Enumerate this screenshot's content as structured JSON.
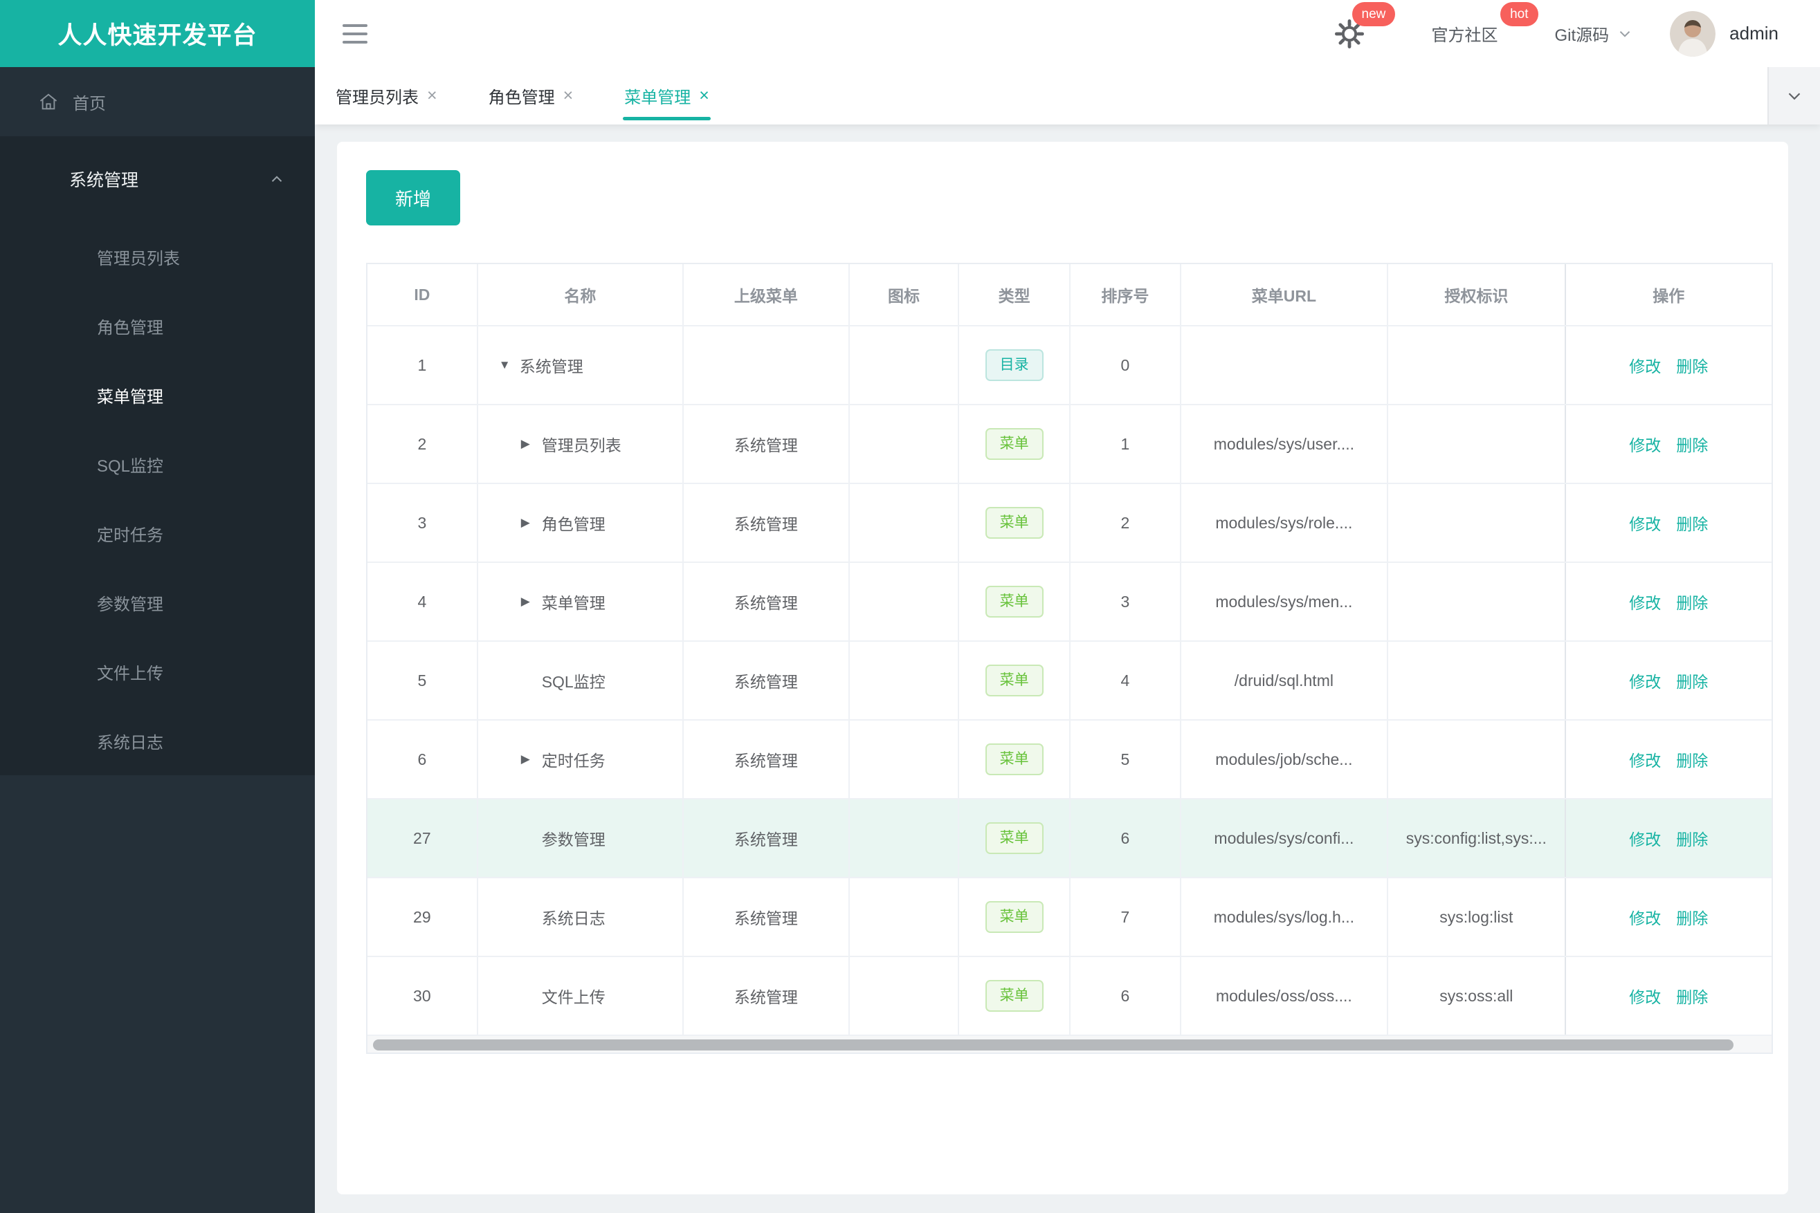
{
  "app": {
    "title": "人人快速开发平台"
  },
  "header": {
    "gear_badge": "new",
    "community": {
      "label": "官方社区",
      "badge": "hot"
    },
    "git": {
      "label": "Git源码"
    },
    "user": "admin"
  },
  "sidebar": {
    "home": {
      "label": "首页"
    },
    "group": {
      "title": "系统管理",
      "items": [
        {
          "label": "管理员列表"
        },
        {
          "label": "角色管理"
        },
        {
          "label": "菜单管理",
          "active": true
        },
        {
          "label": "SQL监控"
        },
        {
          "label": "定时任务"
        },
        {
          "label": "参数管理"
        },
        {
          "label": "文件上传"
        },
        {
          "label": "系统日志"
        }
      ]
    }
  },
  "tabs": [
    {
      "label": "管理员列表"
    },
    {
      "label": "角色管理"
    },
    {
      "label": "菜单管理",
      "active": true
    }
  ],
  "glyphs": {
    "close": "×"
  },
  "toolbar": {
    "add_label": "新增"
  },
  "table": {
    "columns": [
      "ID",
      "名称",
      "上级菜单",
      "图标",
      "类型",
      "排序号",
      "菜单URL",
      "授权标识",
      "操作"
    ],
    "actions": {
      "edit": "修改",
      "delete": "删除"
    },
    "rows": [
      {
        "id": "1",
        "expand": "▼",
        "name": "系统管理",
        "parent": "",
        "icon": "",
        "type": "目录",
        "order": "0",
        "url": "",
        "perms": ""
      },
      {
        "id": "2",
        "expand": "▶",
        "name": "管理员列表",
        "parent": "系统管理",
        "icon": "",
        "type": "菜单",
        "order": "1",
        "url": "modules/sys/user....",
        "perms": ""
      },
      {
        "id": "3",
        "expand": "▶",
        "name": "角色管理",
        "parent": "系统管理",
        "icon": "",
        "type": "菜单",
        "order": "2",
        "url": "modules/sys/role....",
        "perms": ""
      },
      {
        "id": "4",
        "expand": "▶",
        "name": "菜单管理",
        "parent": "系统管理",
        "icon": "",
        "type": "菜单",
        "order": "3",
        "url": "modules/sys/men...",
        "perms": ""
      },
      {
        "id": "5",
        "expand": "",
        "name": "SQL监控",
        "parent": "系统管理",
        "icon": "",
        "type": "菜单",
        "order": "4",
        "url": "/druid/sql.html",
        "perms": ""
      },
      {
        "id": "6",
        "expand": "▶",
        "name": "定时任务",
        "parent": "系统管理",
        "icon": "",
        "type": "菜单",
        "order": "5",
        "url": "modules/job/sche...",
        "perms": ""
      },
      {
        "id": "27",
        "expand": "",
        "name": "参数管理",
        "parent": "系统管理",
        "icon": "",
        "type": "菜单",
        "order": "6",
        "url": "modules/sys/confi...",
        "perms": "sys:config:list,sys:...",
        "highlighted": true
      },
      {
        "id": "29",
        "expand": "",
        "name": "系统日志",
        "parent": "系统管理",
        "icon": "",
        "type": "菜单",
        "order": "7",
        "url": "modules/sys/log.h...",
        "perms": "sys:log:list"
      },
      {
        "id": "30",
        "expand": "",
        "name": "文件上传",
        "parent": "系统管理",
        "icon": "",
        "type": "菜单",
        "order": "6",
        "url": "modules/oss/oss....",
        "perms": "sys:oss:all"
      }
    ]
  },
  "colors": {
    "primary": "#17b3a3",
    "badge": "#f7605c",
    "sidebar-bg": "#253039",
    "submenu-bg": "#1e272e",
    "sidebar-text": "#8a939b",
    "content-bg": "#eef1f3",
    "row-highlight": "#e9f6f2",
    "tag-dir-text": "#17b3a3",
    "tag-dir-bg": "#e8f6f4",
    "tag-dir-border": "#bce5df",
    "tag-menu-text": "#67c23a",
    "tag-menu-bg": "#f0f9eb",
    "tag-menu-border": "#c9e9b6"
  }
}
